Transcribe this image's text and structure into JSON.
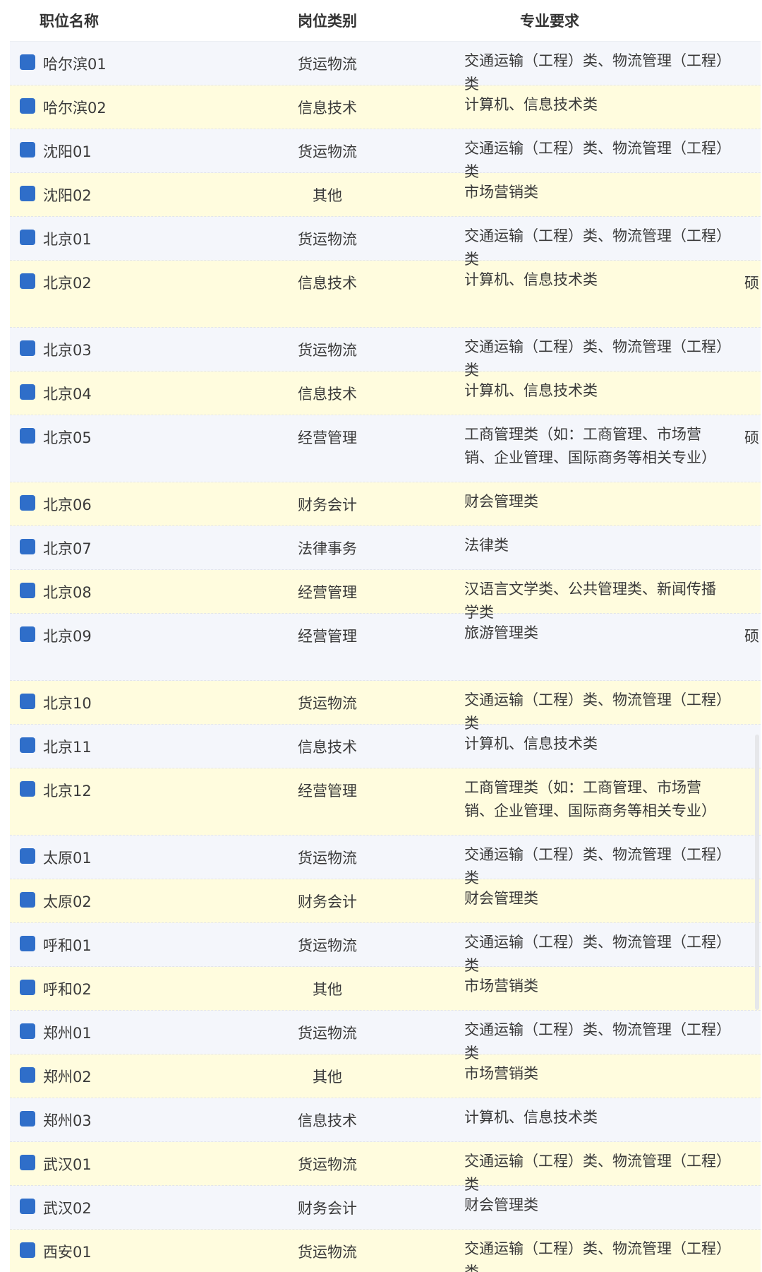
{
  "headers": {
    "col1": "职位名称",
    "col2": "岗位类别",
    "col3": "专业要求"
  },
  "rows": [
    {
      "name": "哈尔滨01",
      "category": "货运物流",
      "major": "交通运输（工程）类、物流管理（工程）类",
      "extra": ""
    },
    {
      "name": "哈尔滨02",
      "category": "信息技术",
      "major": "计算机、信息技术类",
      "extra": ""
    },
    {
      "name": "沈阳01",
      "category": "货运物流",
      "major": "交通运输（工程）类、物流管理（工程）类",
      "extra": ""
    },
    {
      "name": "沈阳02",
      "category": "其他",
      "major": "市场营销类",
      "extra": ""
    },
    {
      "name": "北京01",
      "category": "货运物流",
      "major": "交通运输（工程）类、物流管理（工程）类",
      "extra": ""
    },
    {
      "name": "北京02",
      "category": "信息技术",
      "major": "计算机、信息技术类",
      "extra": "硕"
    },
    {
      "name": "北京03",
      "category": "货运物流",
      "major": "交通运输（工程）类、物流管理（工程）类",
      "extra": ""
    },
    {
      "name": "北京04",
      "category": "信息技术",
      "major": "计算机、信息技术类",
      "extra": ""
    },
    {
      "name": "北京05",
      "category": "经营管理",
      "major": "工商管理类（如：工商管理、市场营销、企业管理、国际商务等相关专业）",
      "extra": "硕"
    },
    {
      "name": "北京06",
      "category": "财务会计",
      "major": "财会管理类",
      "extra": ""
    },
    {
      "name": "北京07",
      "category": "法律事务",
      "major": "法律类",
      "extra": ""
    },
    {
      "name": "北京08",
      "category": "经营管理",
      "major": "汉语言文学类、公共管理类、新闻传播学类",
      "extra": ""
    },
    {
      "name": "北京09",
      "category": "经营管理",
      "major": "旅游管理类",
      "extra": "硕"
    },
    {
      "name": "北京10",
      "category": "货运物流",
      "major": "交通运输（工程）类、物流管理（工程）类",
      "extra": ""
    },
    {
      "name": "北京11",
      "category": "信息技术",
      "major": "计算机、信息技术类",
      "extra": ""
    },
    {
      "name": "北京12",
      "category": "经营管理",
      "major": "工商管理类（如：工商管理、市场营销、企业管理、国际商务等相关专业）",
      "extra": ""
    },
    {
      "name": "太原01",
      "category": "货运物流",
      "major": "交通运输（工程）类、物流管理（工程）类",
      "extra": ""
    },
    {
      "name": "太原02",
      "category": "财务会计",
      "major": "财会管理类",
      "extra": ""
    },
    {
      "name": "呼和01",
      "category": "货运物流",
      "major": "交通运输（工程）类、物流管理（工程）类",
      "extra": ""
    },
    {
      "name": "呼和02",
      "category": "其他",
      "major": "市场营销类",
      "extra": ""
    },
    {
      "name": "郑州01",
      "category": "货运物流",
      "major": "交通运输（工程）类、物流管理（工程）类",
      "extra": ""
    },
    {
      "name": "郑州02",
      "category": "其他",
      "major": "市场营销类",
      "extra": ""
    },
    {
      "name": "郑州03",
      "category": "信息技术",
      "major": "计算机、信息技术类",
      "extra": ""
    },
    {
      "name": "武汉01",
      "category": "货运物流",
      "major": "交通运输（工程）类、物流管理（工程）类",
      "extra": ""
    },
    {
      "name": "武汉02",
      "category": "财务会计",
      "major": "财会管理类",
      "extra": ""
    },
    {
      "name": "西安01",
      "category": "货运物流",
      "major": "交通运输（工程）类、物流管理（工程）类",
      "extra": ""
    }
  ],
  "colors": {
    "checkbox": "#2f6ec9",
    "row_blue": "#f4f6fb",
    "row_yellow": "#fffcde"
  }
}
